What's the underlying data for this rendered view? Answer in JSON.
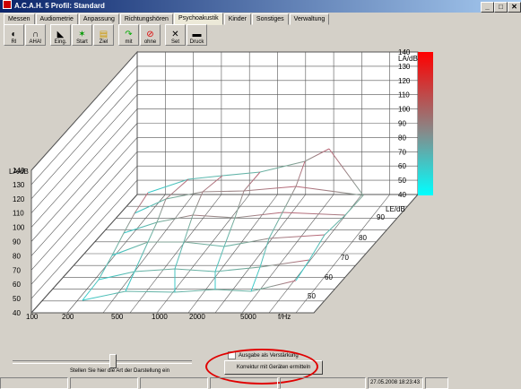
{
  "window": {
    "title": "A.C.A.H. 5  Profil: Standard",
    "buttons": [
      "_",
      "□",
      "✕"
    ]
  },
  "tabs": [
    {
      "label": "Messen"
    },
    {
      "label": "Audiometrie"
    },
    {
      "label": "Anpassung"
    },
    {
      "label": "Richtungshören"
    },
    {
      "label": "Psychoakustik",
      "active": true
    },
    {
      "label": "Kinder"
    },
    {
      "label": "Sonstiges"
    },
    {
      "label": "Verwaltung"
    }
  ],
  "toolbar": [
    {
      "label": "RI",
      "icon": "ear-icon"
    },
    {
      "label": "AHA!",
      "icon": "headphones-icon"
    },
    {
      "label": "Eing.",
      "icon": "input-icon"
    },
    {
      "label": "Start",
      "icon": "start-icon"
    },
    {
      "label": "Ziel",
      "icon": "target-icon"
    },
    {
      "label": "mit",
      "icon": "with-icon"
    },
    {
      "label": "ohne",
      "icon": "without-icon"
    },
    {
      "label": "Set",
      "icon": "tools-icon"
    },
    {
      "label": "Druck",
      "icon": "printer-icon"
    }
  ],
  "plot": {
    "y_label": "LA/dB",
    "y_ticks": [
      "140",
      "130",
      "120",
      "110",
      "100",
      "90",
      "80",
      "70",
      "60",
      "50",
      "40"
    ],
    "right_label": "LA/dB",
    "right_ticks": [
      "140",
      "130",
      "120",
      "110",
      "100",
      "90",
      "80",
      "70",
      "60",
      "50",
      "40"
    ],
    "x_label": "f/Hz",
    "x_ticks": [
      "100",
      "200",
      "500",
      "1000",
      "2000",
      "5000"
    ],
    "z_label": "LE/dB",
    "z_ticks": [
      "90",
      "80",
      "70",
      "60",
      "50"
    ],
    "colorbar": {
      "top": "#ff0000",
      "middle": "#888888",
      "bottom": "#00ffff"
    }
  },
  "controls": {
    "slider_hint": "Stellen Sie hier die Art der Darstellung ein",
    "checkbox_label": "Ausgabe als Verstärkung",
    "korrektur_button": "Korrektur mit Geräten ermitteln"
  },
  "status": {
    "datetime": "27.05.2008 18:23:43"
  }
}
